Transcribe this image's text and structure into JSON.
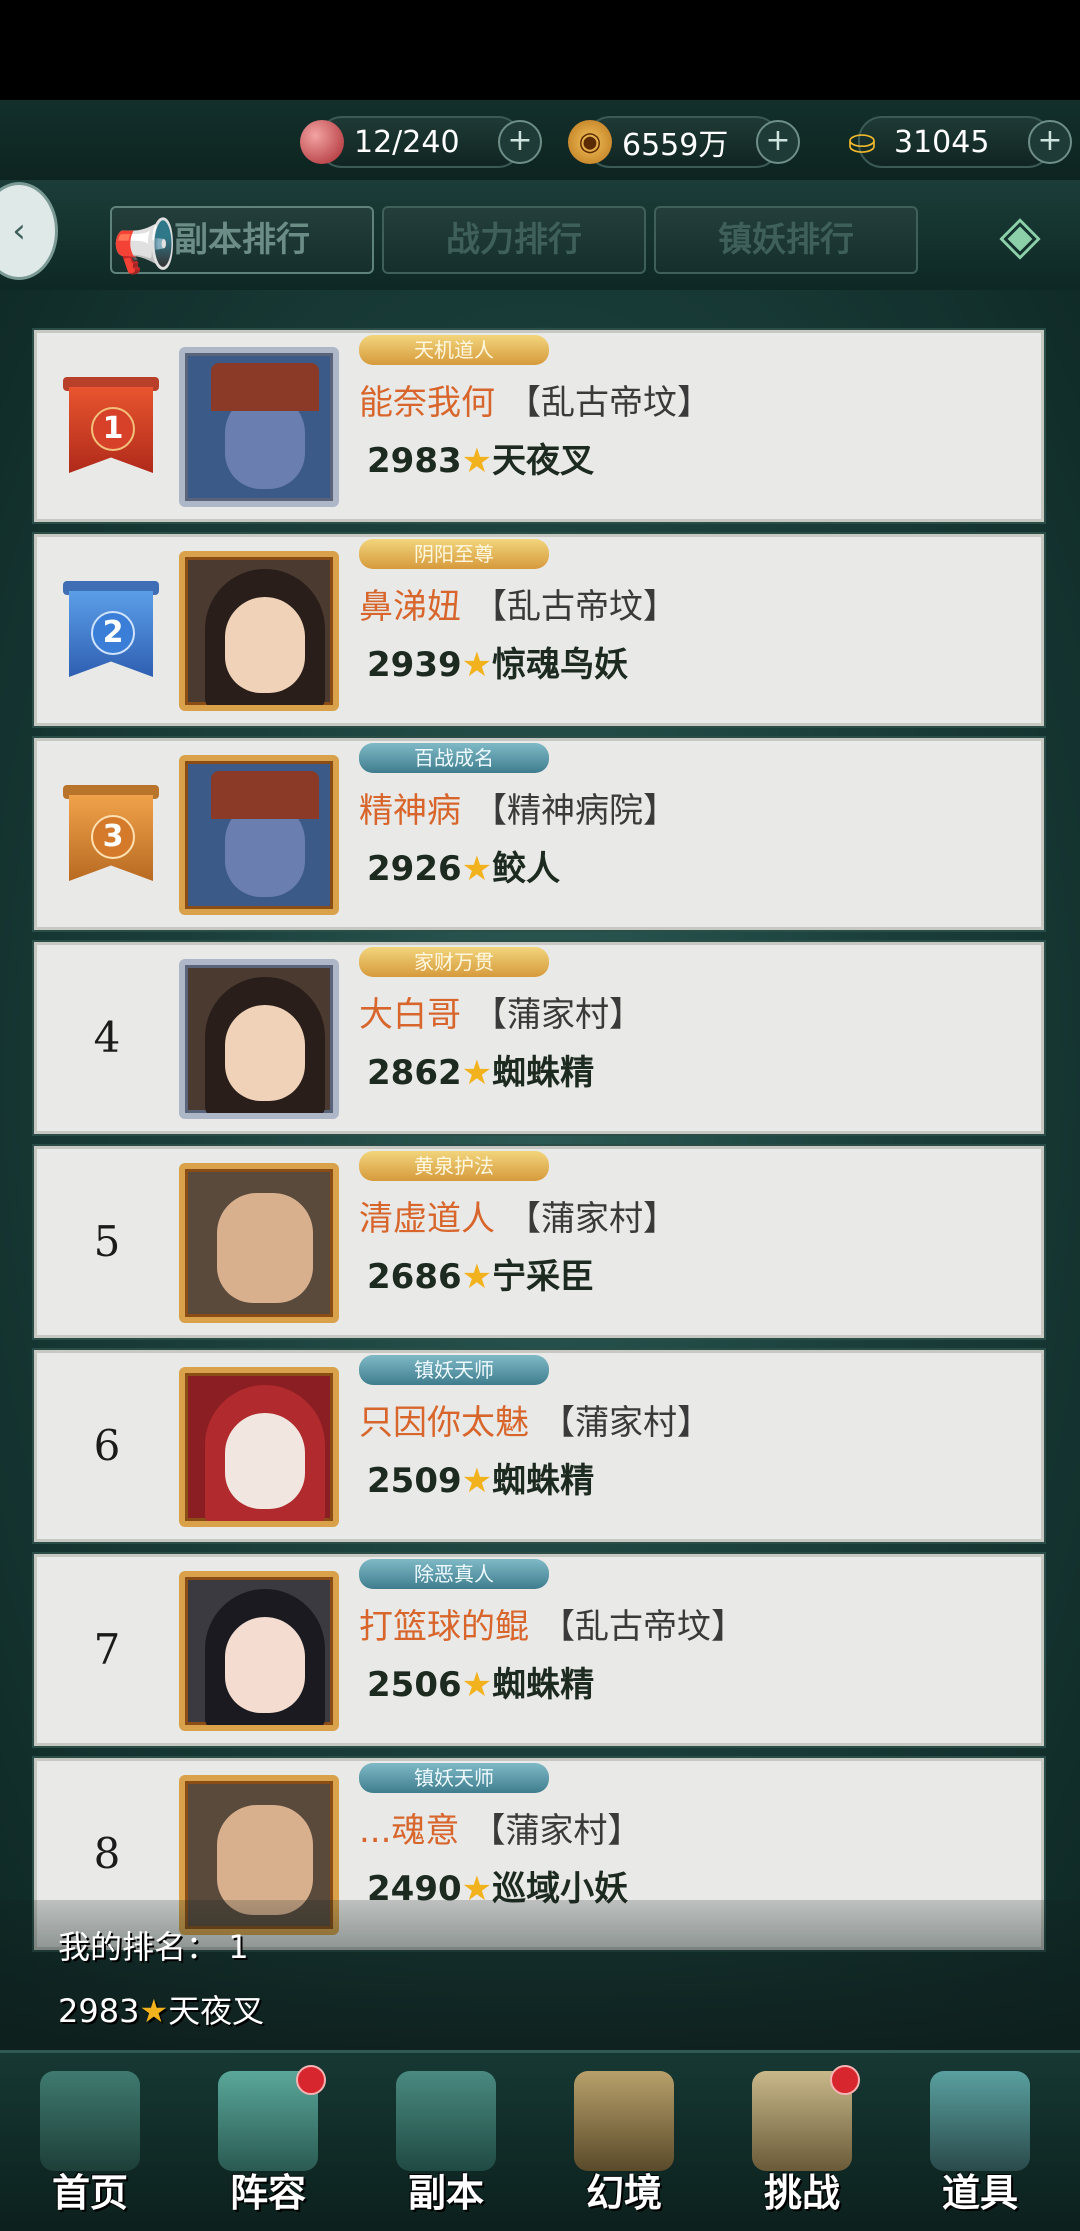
{
  "resources": [
    {
      "icon": "red-orb-icon",
      "value": "12/240"
    },
    {
      "icon": "coin-icon",
      "value": "6559万"
    },
    {
      "icon": "gold-ingot-icon",
      "value": "31045"
    }
  ],
  "tabs": [
    "副本排行",
    "战力排行",
    "镇妖排行"
  ],
  "rows": [
    {
      "rank": "1",
      "title": "天机道人",
      "name": "能奈我何",
      "server": "【乱古帝坟】",
      "power": "2983",
      "pet": "天夜叉"
    },
    {
      "rank": "2",
      "title": "阴阳至尊",
      "name": "鼻涕妞",
      "server": "【乱古帝坟】",
      "power": "2939",
      "pet": "惊魂鸟妖"
    },
    {
      "rank": "3",
      "title": "百战成名",
      "name": "精神病",
      "server": "【精神病院】",
      "power": "2926",
      "pet": "鲛人"
    },
    {
      "rank": "4",
      "title": "家财万贯",
      "name": "大白哥",
      "server": "【蒲家村】",
      "power": "2862",
      "pet": "蜘蛛精"
    },
    {
      "rank": "5",
      "title": "黄泉护法",
      "name": "清虚道人",
      "server": "【蒲家村】",
      "power": "2686",
      "pet": "宁采臣"
    },
    {
      "rank": "6",
      "title": "镇妖天师",
      "name": "只因你太魅",
      "server": "【蒲家村】",
      "power": "2509",
      "pet": "蜘蛛精"
    },
    {
      "rank": "7",
      "title": "除恶真人",
      "name": "打篮球的鲲",
      "server": "【乱古帝坟】",
      "power": "2506",
      "pet": "蜘蛛精"
    },
    {
      "rank": "8",
      "title": "镇妖天师",
      "name": "...魂意",
      "server": "【蒲家村】",
      "power": "2490",
      "pet": "巡域小妖"
    }
  ],
  "my_rank": {
    "label": "我的排名：",
    "rank": "1",
    "power": "2983",
    "pet": "天夜叉"
  },
  "nav": [
    {
      "label": "首页",
      "icon": "home-pavilion-icon",
      "dot": false
    },
    {
      "label": "阵容",
      "icon": "lineup-book-icon",
      "dot": true
    },
    {
      "label": "副本",
      "icon": "dungeon-sword-icon",
      "dot": false
    },
    {
      "label": "幻境",
      "icon": "crossed-swords-icon",
      "dot": false
    },
    {
      "label": "挑战",
      "icon": "scroll-map-icon",
      "dot": true
    },
    {
      "label": "道具",
      "icon": "item-bag-icon",
      "dot": false
    }
  ],
  "colors": {
    "name": "#d8662c",
    "gold_frame": "#d9a24a",
    "silver_frame": "#aeb7c8",
    "star": "#f2b21e",
    "notify_dot": "#d8262e"
  }
}
